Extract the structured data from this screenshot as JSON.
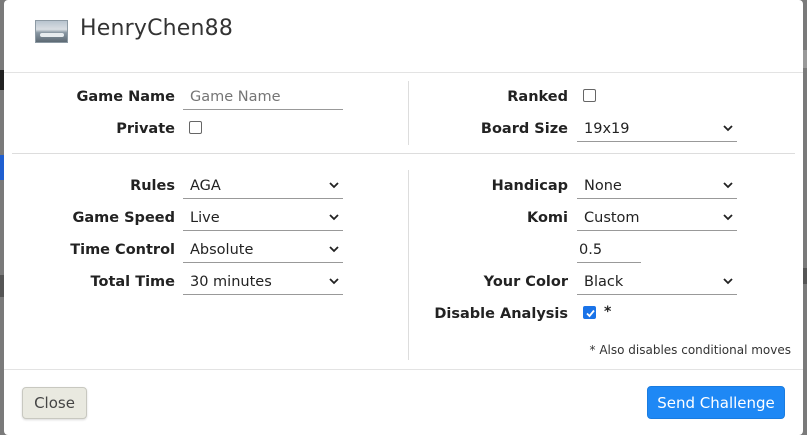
{
  "header": {
    "username": "HenryChen88",
    "avatar_icon": "avatar-landscape-image"
  },
  "fields": {
    "game_name": {
      "label": "Game Name",
      "placeholder": "Game Name",
      "value": ""
    },
    "private": {
      "label": "Private",
      "checked": false
    },
    "ranked": {
      "label": "Ranked",
      "checked": false
    },
    "board_size": {
      "label": "Board Size",
      "value": "19x19"
    },
    "rules": {
      "label": "Rules",
      "value": "AGA"
    },
    "game_speed": {
      "label": "Game Speed",
      "value": "Live"
    },
    "time_control": {
      "label": "Time Control",
      "value": "Absolute"
    },
    "total_time": {
      "label": "Total Time",
      "value": "30 minutes"
    },
    "handicap": {
      "label": "Handicap",
      "value": "None"
    },
    "komi": {
      "label": "Komi",
      "value": "Custom",
      "custom_value": "0.5"
    },
    "your_color": {
      "label": "Your Color",
      "value": "Black"
    },
    "disable_analysis": {
      "label": "Disable Analysis",
      "checked": true,
      "asterisk": "*"
    }
  },
  "note": "* Also disables conditional moves",
  "footer": {
    "close_label": "Close",
    "send_label": "Send Challenge"
  },
  "colors": {
    "primary_button": "#1e88f5",
    "checkbox_checked": "#1a73e8",
    "close_button": "#e9e9e0"
  }
}
